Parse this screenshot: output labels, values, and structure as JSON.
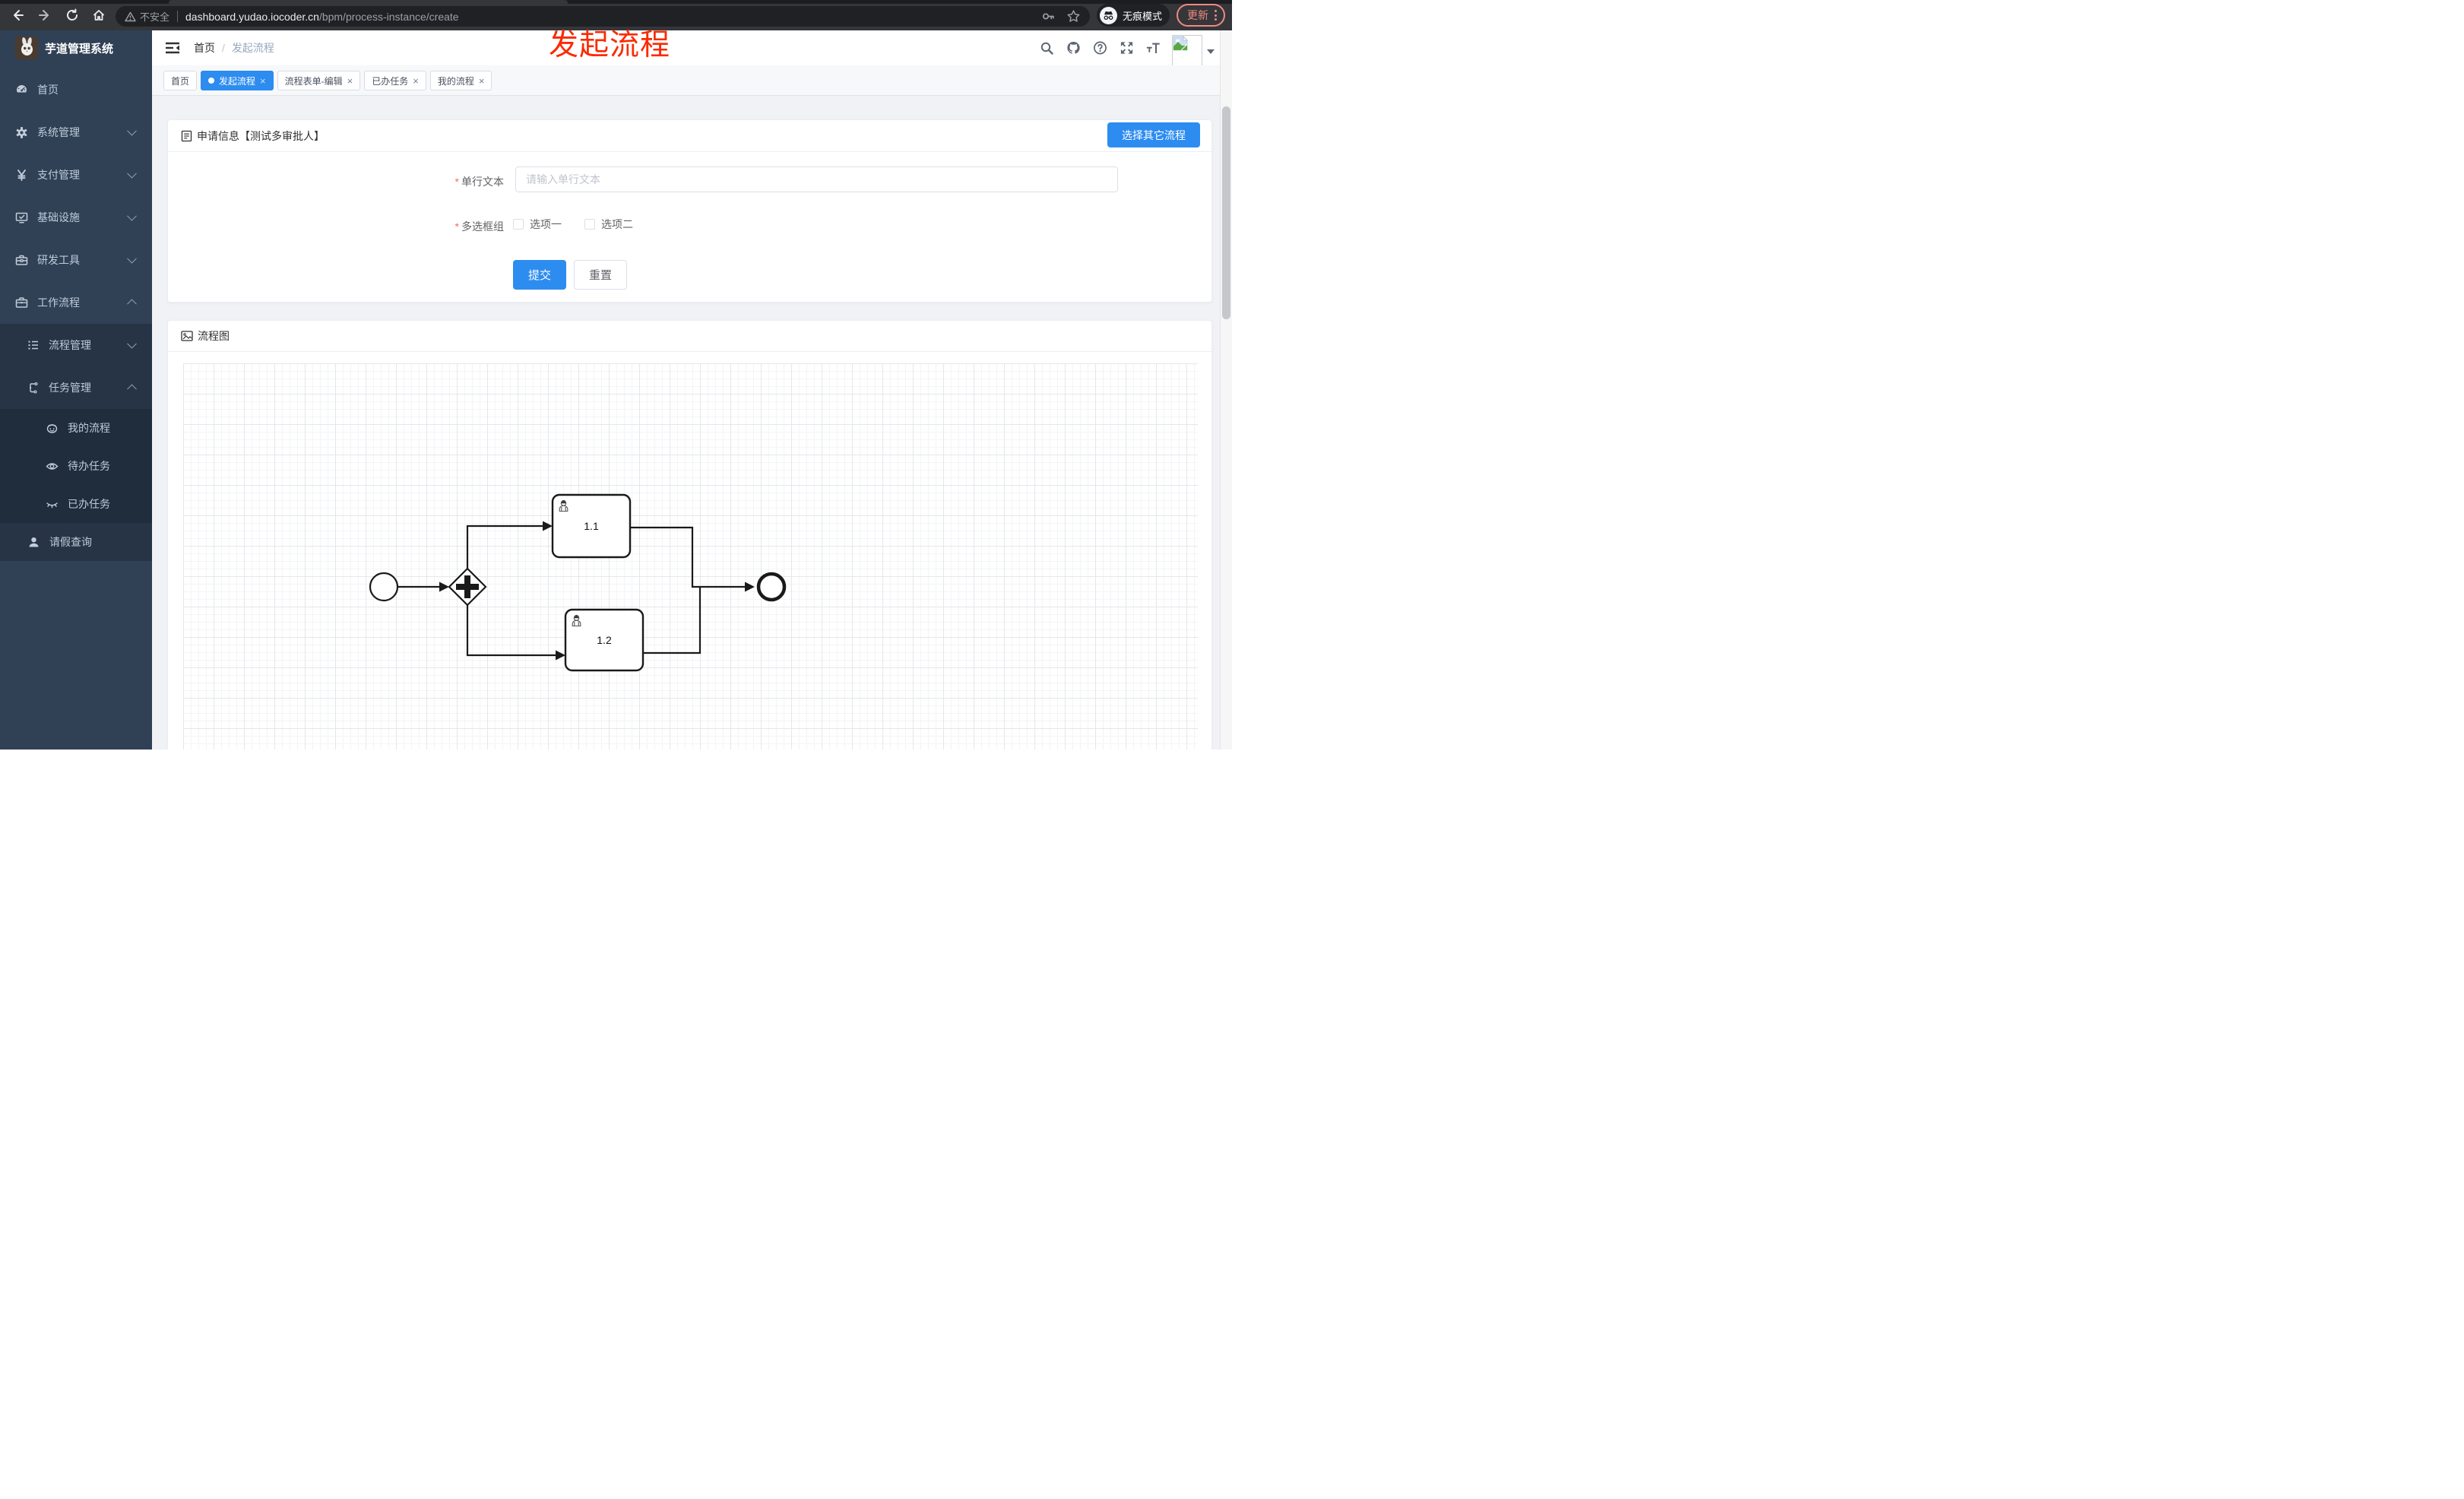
{
  "browser": {
    "security_label": "不安全",
    "url_domain": "dashboard.yudao.iocoder.cn",
    "url_path": "/bpm/process-instance/create",
    "incognito_label": "无痕模式",
    "update_label": "更新"
  },
  "annotation": {
    "title": "发起流程"
  },
  "sidebar": {
    "app_title": "芋道管理系统",
    "items": [
      {
        "label": "首页",
        "icon": "dashboard-icon",
        "level": 1
      },
      {
        "label": "系统管理",
        "icon": "gear-icon",
        "level": 1,
        "chevron": "down"
      },
      {
        "label": "支付管理",
        "icon": "yen-icon",
        "level": 1,
        "chevron": "down"
      },
      {
        "label": "基础设施",
        "icon": "monitor-icon",
        "level": 1,
        "chevron": "down"
      },
      {
        "label": "研发工具",
        "icon": "toolbox-icon",
        "level": 1,
        "chevron": "down"
      },
      {
        "label": "工作流程",
        "icon": "briefcase-icon",
        "level": 1,
        "chevron": "up"
      },
      {
        "label": "流程管理",
        "icon": "list-icon",
        "level": 2,
        "chevron": "down"
      },
      {
        "label": "任务管理",
        "icon": "tree-icon",
        "level": 2,
        "chevron": "up"
      },
      {
        "label": "我的流程",
        "icon": "face-icon",
        "level": 3
      },
      {
        "label": "待办任务",
        "icon": "eye-icon",
        "level": 3
      },
      {
        "label": "已办任务",
        "icon": "eye-off-icon",
        "level": 3
      },
      {
        "label": "请假查询",
        "icon": "user-icon",
        "level": 2
      }
    ]
  },
  "header": {
    "breadcrumb": [
      "首页",
      "发起流程"
    ],
    "breadcrumb_separator": "/"
  },
  "tabs": [
    {
      "label": "首页",
      "active": false,
      "closable": false
    },
    {
      "label": "发起流程",
      "active": true,
      "closable": true
    },
    {
      "label": "流程表单-编辑",
      "active": false,
      "closable": true
    },
    {
      "label": "已办任务",
      "active": false,
      "closable": true
    },
    {
      "label": "我的流程",
      "active": false,
      "closable": true
    }
  ],
  "ui": {
    "close_glyph": "×",
    "required_glyph": "*"
  },
  "form_card": {
    "title": "申请信息【测试多审批人】",
    "choose_other_button": "选择其它流程",
    "fields": [
      {
        "label": "单行文本",
        "required": true,
        "placeholder": "请输入单行文本",
        "value": ""
      },
      {
        "label": "多选框组",
        "required": true,
        "options": [
          {
            "label": "选项一",
            "checked": false
          },
          {
            "label": "选项二",
            "checked": false
          }
        ]
      }
    ],
    "submit_label": "提交",
    "reset_label": "重置"
  },
  "flow_card": {
    "title": "流程图",
    "diagram": {
      "type": "bpmn",
      "nodes": [
        {
          "id": "start",
          "type": "start-event"
        },
        {
          "id": "gateway",
          "type": "parallel-gateway"
        },
        {
          "id": "task-1-1",
          "type": "user-task",
          "label": "1.1"
        },
        {
          "id": "task-1-2",
          "type": "user-task",
          "label": "1.2"
        },
        {
          "id": "end",
          "type": "end-event"
        }
      ],
      "edges": [
        [
          "start",
          "gateway"
        ],
        [
          "gateway",
          "task-1-1"
        ],
        [
          "gateway",
          "task-1-2"
        ],
        [
          "task-1-1",
          "end"
        ],
        [
          "task-1-2",
          "end"
        ]
      ]
    }
  },
  "colors": {
    "primary": "#2d8cf0",
    "annotation_red": "#fb2a00",
    "sidebar_bg": "#304156",
    "submenu_bg": "#263445",
    "submenu_deep_bg": "#1f2d3d",
    "update_red": "#ef8a80"
  }
}
